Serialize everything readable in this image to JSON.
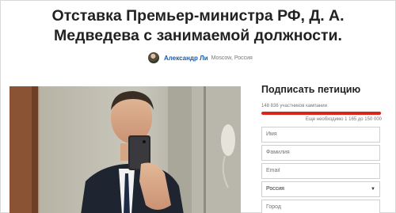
{
  "petition": {
    "title": "Отставка Премьер-министра РФ, Д. А. Медведева с занимаемой должности.",
    "author": {
      "name": "Александр Ли",
      "location": "Moscow, Россия"
    }
  },
  "sign_form": {
    "heading": "Подписать петицию",
    "participants_text": "148 836 участников кампании",
    "needed_text": "Еще необходимо 1 165 до 150 000",
    "progress_fraction": 0.992,
    "progress_color": "#d9231b",
    "fields": [
      {
        "placeholder": "Имя"
      },
      {
        "placeholder": "Фамилия"
      },
      {
        "placeholder": "Email"
      }
    ],
    "country_selected": "Россия",
    "city_placeholder": "Город"
  }
}
